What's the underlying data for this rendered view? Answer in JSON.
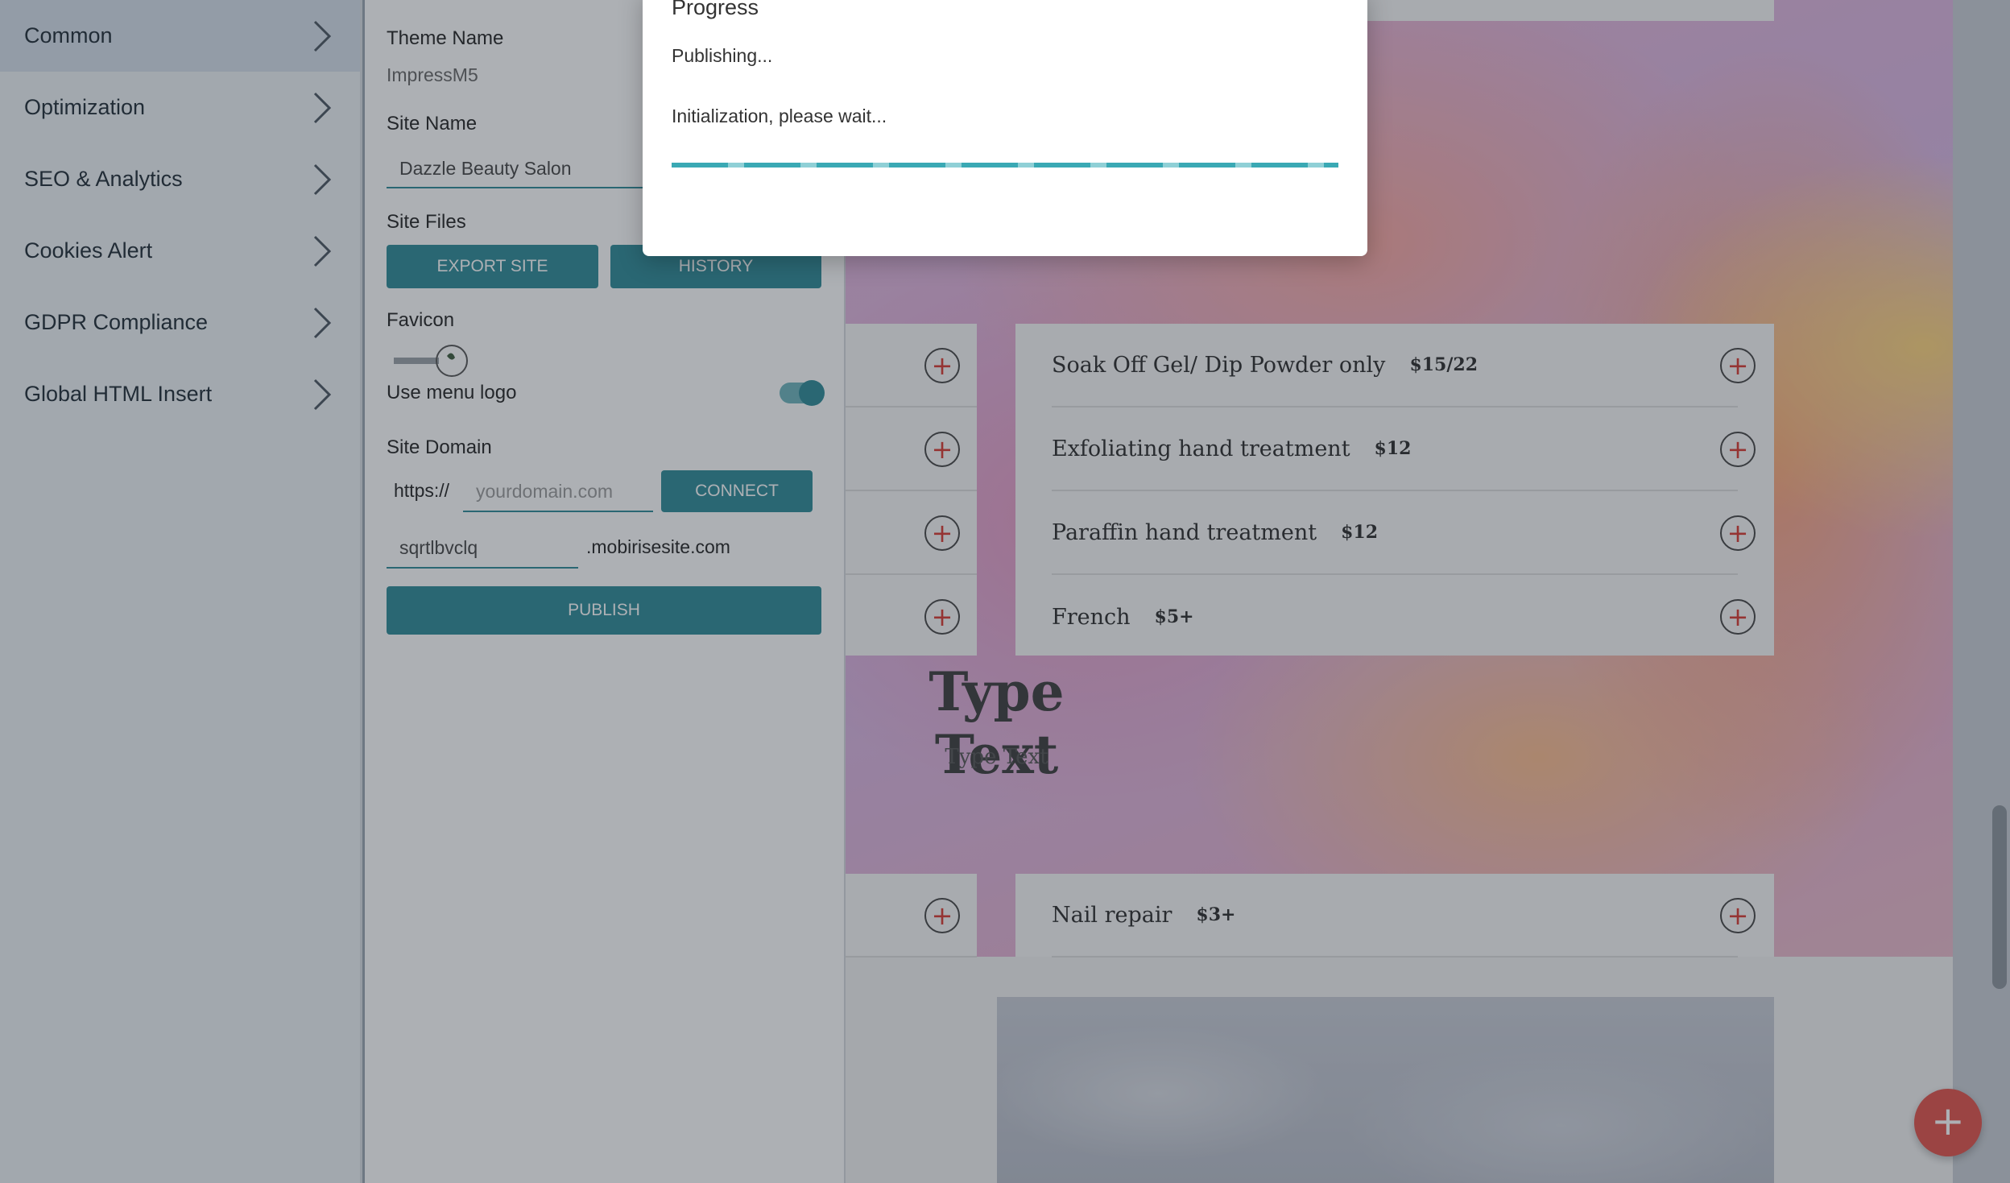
{
  "sidebar": {
    "items": [
      {
        "label": "Common"
      },
      {
        "label": "Optimization"
      },
      {
        "label": "SEO & Analytics"
      },
      {
        "label": "Cookies Alert"
      },
      {
        "label": "GDPR Compliance"
      },
      {
        "label": "Global HTML Insert"
      }
    ]
  },
  "panel": {
    "theme_name_label": "Theme Name",
    "theme_name_value": "ImpressM5",
    "site_name_label": "Site Name",
    "site_name_value": "Dazzle Beauty Salon",
    "site_files_label": "Site Files",
    "export_button": "EXPORT SITE",
    "history_button": "HISTORY",
    "favicon_label": "Favicon",
    "use_menu_logo_label": "Use menu logo",
    "use_menu_logo_on": true,
    "site_domain_label": "Site Domain",
    "https_prefix": "https://",
    "domain_placeholder": "yourdomain.com",
    "connect_button": "CONNECT",
    "subdomain_value": "sqrtlbvclq",
    "subdomain_suffix": ".mobirisesite.com",
    "publish_button": "PUBLISH"
  },
  "modal": {
    "title": "Progress",
    "status": "Publishing...",
    "message": "Initialization, please wait..."
  },
  "preview": {
    "menu_items": [
      {
        "name": "Soak Off Gel/ Dip Powder only",
        "price": "$15/22"
      },
      {
        "name": "Exfoliating hand treatment",
        "price": "$12"
      },
      {
        "name": "Paraffin hand treatment",
        "price": "$12"
      },
      {
        "name": "French",
        "price": "$5+"
      }
    ],
    "menu_items_lower": [
      {
        "name": "Nail repair",
        "price": "$3+"
      }
    ],
    "type_title": "Type Text",
    "type_subtitle": "Type Text",
    "plus_glyph": "+",
    "fab_glyph": "+"
  },
  "colors": {
    "accent": "#2c8a96",
    "fab": "#e3514a",
    "plus_icon": "#d9382f"
  }
}
